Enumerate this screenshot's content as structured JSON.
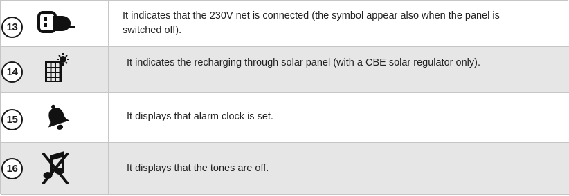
{
  "rows": [
    {
      "number": "13",
      "icon": "mains-plug-icon",
      "text": "It indicates that the 230V net is connected (the symbol appear also when the panel is switched off)."
    },
    {
      "number": "14",
      "icon": "solar-panel-icon",
      "text": "It indicates the recharging through solar panel (with a CBE solar regulator only)."
    },
    {
      "number": "15",
      "icon": "bell-icon",
      "text": "It displays that alarm clock is set."
    },
    {
      "number": "16",
      "icon": "tones-off-icon",
      "text": "It displays that the tones are off."
    }
  ],
  "colors": {
    "shaded_row": "#e6e6e6",
    "border": "#c6c6c6",
    "text": "#222222"
  }
}
